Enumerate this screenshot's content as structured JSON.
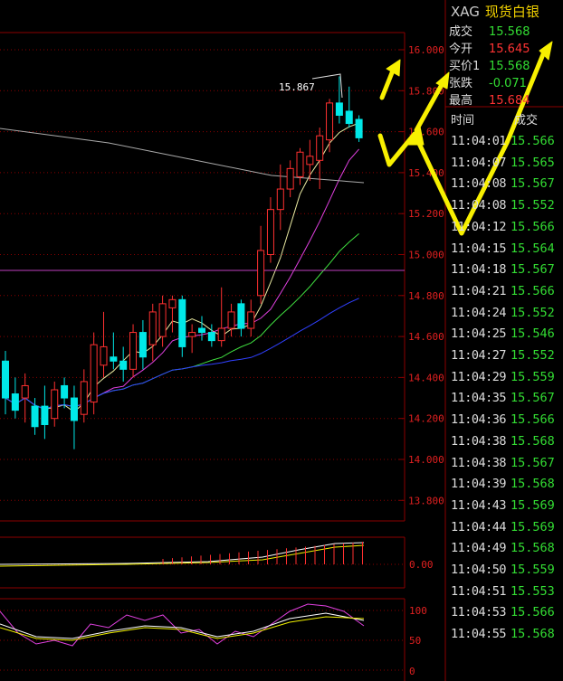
{
  "header": {
    "code": "XAG",
    "name": "现货白银"
  },
  "quote": [
    {
      "label": "成交",
      "value": "15.568",
      "color": "#33dd33"
    },
    {
      "label": "今开",
      "value": "15.645",
      "color": "#ff3333"
    },
    {
      "label": "买价1",
      "value": "15.568",
      "color": "#33dd33"
    },
    {
      "label": "张跌",
      "value": "-0.071",
      "color": "#33dd33"
    },
    {
      "label": "最高",
      "value": "15.684",
      "color": "#ff3333"
    }
  ],
  "tick_headers": {
    "time": "时间",
    "price": "成交"
  },
  "ticks": [
    {
      "time": "11:04:01",
      "price": "15.566"
    },
    {
      "time": "11:04:07",
      "price": "15.565"
    },
    {
      "time": "11:04:08",
      "price": "15.567"
    },
    {
      "time": "11:04:08",
      "price": "15.552"
    },
    {
      "time": "11:04:12",
      "price": "15.566"
    },
    {
      "time": "11:04:15",
      "price": "15.564"
    },
    {
      "time": "11:04:18",
      "price": "15.567"
    },
    {
      "time": "11:04:21",
      "price": "15.566"
    },
    {
      "time": "11:04:24",
      "price": "15.552"
    },
    {
      "time": "11:04:25",
      "price": "15.546"
    },
    {
      "time": "11:04:27",
      "price": "15.552"
    },
    {
      "time": "11:04:29",
      "price": "15.559"
    },
    {
      "time": "11:04:35",
      "price": "15.567"
    },
    {
      "time": "11:04:36",
      "price": "15.566"
    },
    {
      "time": "11:04:38",
      "price": "15.568"
    },
    {
      "time": "11:04:38",
      "price": "15.567"
    },
    {
      "time": "11:04:39",
      "price": "15.568"
    },
    {
      "time": "11:04:43",
      "price": "15.569"
    },
    {
      "time": "11:04:44",
      "price": "15.569"
    },
    {
      "time": "11:04:49",
      "price": "15.568"
    },
    {
      "time": "11:04:50",
      "price": "15.559"
    },
    {
      "time": "11:04:51",
      "price": "15.553"
    },
    {
      "time": "11:04:53",
      "price": "15.566"
    },
    {
      "time": "11:04:55",
      "price": "15.568"
    }
  ],
  "colors": {
    "up": "#ff3030",
    "down": "#00e8e8",
    "grid": "#8b0000",
    "tick_price": "#33dd33",
    "arrow": "#f8f000"
  },
  "chart_data": {
    "type": "candlestick",
    "ylim": [
      13.6,
      16.1
    ],
    "yticks": [
      "16.000",
      "15.800",
      "15.600",
      "15.400",
      "15.200",
      "15.000",
      "14.800",
      "14.600",
      "14.400",
      "14.200",
      "14.000",
      "13.800"
    ],
    "annotation": "15.867",
    "candles": [
      {
        "o": 14.48,
        "h": 14.53,
        "l": 14.22,
        "c": 14.3
      },
      {
        "o": 14.32,
        "h": 14.4,
        "l": 14.2,
        "c": 14.24
      },
      {
        "o": 14.3,
        "h": 14.42,
        "l": 14.18,
        "c": 14.36
      },
      {
        "o": 14.26,
        "h": 14.3,
        "l": 14.12,
        "c": 14.16
      },
      {
        "o": 14.26,
        "h": 14.36,
        "l": 14.1,
        "c": 14.17
      },
      {
        "o": 14.2,
        "h": 14.38,
        "l": 14.16,
        "c": 14.34
      },
      {
        "o": 14.36,
        "h": 14.4,
        "l": 14.25,
        "c": 14.3
      },
      {
        "o": 14.3,
        "h": 14.36,
        "l": 14.05,
        "c": 14.19
      },
      {
        "o": 14.22,
        "h": 14.44,
        "l": 14.18,
        "c": 14.38
      },
      {
        "o": 14.28,
        "h": 14.62,
        "l": 14.22,
        "c": 14.56
      },
      {
        "o": 14.46,
        "h": 14.72,
        "l": 14.4,
        "c": 14.55
      },
      {
        "o": 14.5,
        "h": 14.62,
        "l": 14.44,
        "c": 14.48
      },
      {
        "o": 14.48,
        "h": 14.55,
        "l": 14.38,
        "c": 14.44
      },
      {
        "o": 14.44,
        "h": 14.66,
        "l": 14.4,
        "c": 14.62
      },
      {
        "o": 14.62,
        "h": 14.68,
        "l": 14.44,
        "c": 14.5
      },
      {
        "o": 14.56,
        "h": 14.76,
        "l": 14.48,
        "c": 14.72
      },
      {
        "o": 14.6,
        "h": 14.8,
        "l": 14.55,
        "c": 14.76
      },
      {
        "o": 14.74,
        "h": 14.8,
        "l": 14.62,
        "c": 14.78
      },
      {
        "o": 14.78,
        "h": 14.8,
        "l": 14.5,
        "c": 14.55
      },
      {
        "o": 14.6,
        "h": 14.66,
        "l": 14.52,
        "c": 14.62
      },
      {
        "o": 14.64,
        "h": 14.7,
        "l": 14.58,
        "c": 14.62
      },
      {
        "o": 14.62,
        "h": 14.66,
        "l": 14.55,
        "c": 14.58
      },
      {
        "o": 14.58,
        "h": 14.84,
        "l": 14.55,
        "c": 14.64
      },
      {
        "o": 14.64,
        "h": 14.76,
        "l": 14.6,
        "c": 14.72
      },
      {
        "o": 14.76,
        "h": 14.78,
        "l": 14.6,
        "c": 14.64
      },
      {
        "o": 14.64,
        "h": 14.78,
        "l": 14.6,
        "c": 14.72
      },
      {
        "o": 14.8,
        "h": 15.14,
        "l": 14.76,
        "c": 15.02
      },
      {
        "o": 15.0,
        "h": 15.28,
        "l": 14.96,
        "c": 15.22
      },
      {
        "o": 15.22,
        "h": 15.44,
        "l": 15.12,
        "c": 15.32
      },
      {
        "o": 15.32,
        "h": 15.46,
        "l": 15.28,
        "c": 15.42
      },
      {
        "o": 15.38,
        "h": 15.52,
        "l": 15.34,
        "c": 15.5
      },
      {
        "o": 15.44,
        "h": 15.56,
        "l": 15.36,
        "c": 15.48
      },
      {
        "o": 15.46,
        "h": 15.62,
        "l": 15.32,
        "c": 15.58
      },
      {
        "o": 15.56,
        "h": 15.76,
        "l": 15.5,
        "c": 15.74
      },
      {
        "o": 15.74,
        "h": 15.87,
        "l": 15.64,
        "c": 15.68
      },
      {
        "o": 15.7,
        "h": 15.82,
        "l": 15.62,
        "c": 15.64
      },
      {
        "o": 15.66,
        "h": 15.68,
        "l": 15.55,
        "c": 15.57
      }
    ]
  }
}
